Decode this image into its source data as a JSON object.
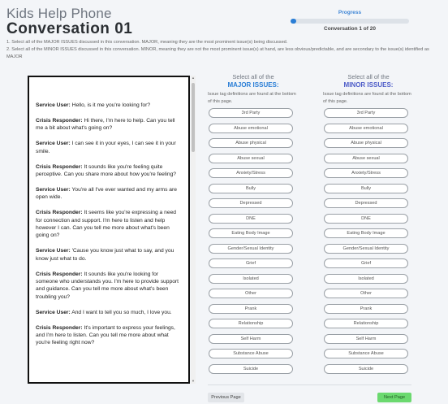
{
  "header": {
    "app_title": "Kids Help Phone",
    "conversation_title": "Conversation 01",
    "progress_label": "Progress",
    "progress_count": "Conversation 1 of 20",
    "progress_fraction": 0.05,
    "accent_color": "#2a7ed6"
  },
  "instructions": {
    "line1": "1. Select all of the MAJOR ISSUES discussed in this conversation. MAJOR, meaning they are the most prominent issue(s) being discussed.",
    "line2": "2. Select all of the MINOR ISSUES discussed in this conversation. MINOR, meaning they are not the most prominent issue(s) at hand, are less obvious/predictable, and are secondary to the issue(s) identified as MAJOR"
  },
  "chat": {
    "messages": [
      {
        "speaker": "Service User:",
        "text": " Hello, is it me you're looking for?"
      },
      {
        "speaker": "Crisis Responder:",
        "text": " Hi there, I'm here to help. Can you tell me a bit about what's going on?"
      },
      {
        "speaker": "Service User:",
        "text": " I can see it in your eyes, I can see it in your smile."
      },
      {
        "speaker": "Crisis Responder:",
        "text": " It sounds like you're feeling quite perceptive. Can you share more about how you're feeling?"
      },
      {
        "speaker": "Service User:",
        "text": " You're all I've ever wanted and my arms are open wide."
      },
      {
        "speaker": "Crisis Responder:",
        "text": " It seems like you're expressing a need for connection and support. I'm here to listen and help however I can. Can you tell me more about what's been going on?"
      },
      {
        "speaker": "Service User:",
        "text": " 'Cause you know just what to say, and you know just what to do."
      },
      {
        "speaker": "Crisis Responder:",
        "text": " It sounds like you're looking for someone who understands you. I'm here to provide support and guidance. Can you tell me more about what's been troubling you?"
      },
      {
        "speaker": "Service User:",
        "text": " And I want to tell you so much, I love you."
      },
      {
        "speaker": "Crisis Responder:",
        "text": " It's important to express your feelings, and I'm here to listen. Can you tell me more about what you're feeling right now?"
      }
    ]
  },
  "major": {
    "select_label": "Select all of the",
    "kind_label": "MAJOR ISSUES:",
    "hint": "Issue tag definitions are found at the bottom of this page."
  },
  "minor": {
    "select_label": "Select all of the",
    "kind_label": "MINOR ISSUES:",
    "hint": "Issue tag definitions are found at the bottom of this page."
  },
  "tags": [
    "3rd Party",
    "Abuse emotional",
    "Abuse physical",
    "Abuse sexual",
    "Anxiety/Stress",
    "Bully",
    "Depressed",
    "DNE",
    "Eating Body Image",
    "Gender/Sexual Identity",
    "Grief",
    "Isolated",
    "Other",
    "Prank",
    "Relationship",
    "Self Harm",
    "Substance Abuse",
    "Suicide"
  ],
  "footer": {
    "prev_label": "Previous Page",
    "next_label": "Next Page",
    "next_color": "#6bd96f"
  }
}
